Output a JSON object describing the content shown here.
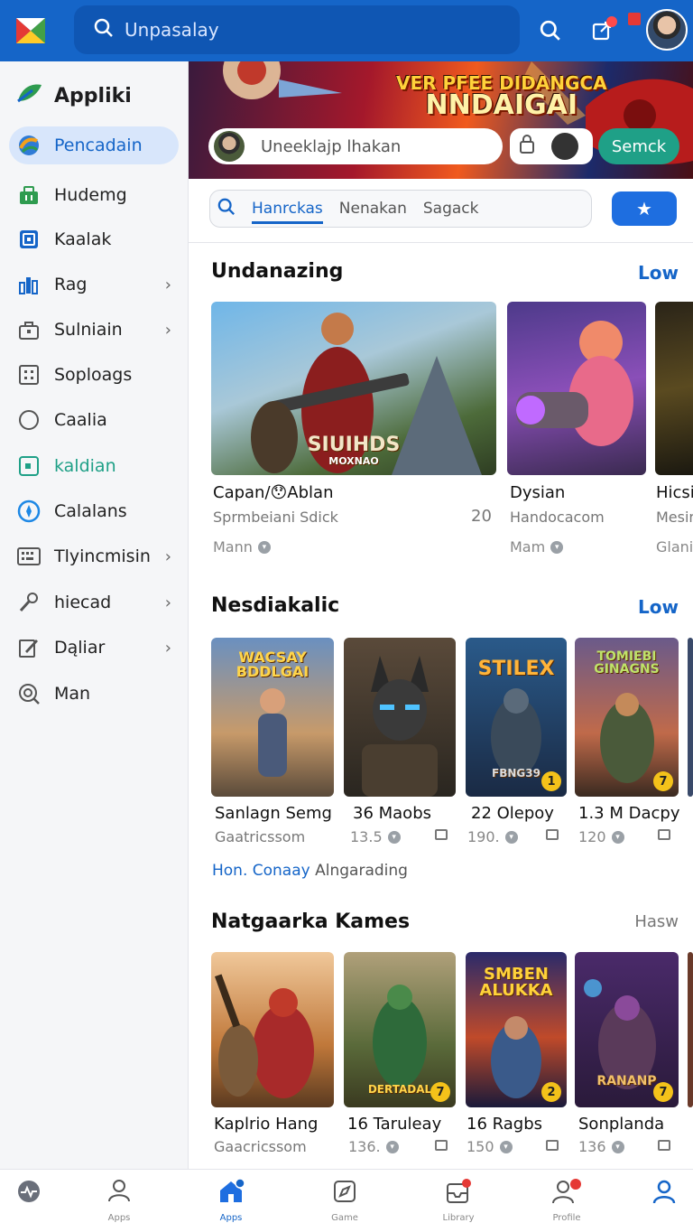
{
  "app": {
    "sidebar_title": "Appliki"
  },
  "search": {
    "placeholder": "Unpasalay"
  },
  "sidebar": {
    "items": [
      {
        "label": "Pencadain",
        "icon": "globe-icon"
      },
      {
        "label": "Hudemg",
        "icon": "store-icon"
      },
      {
        "label": "Kaalak",
        "icon": "tablet-icon"
      },
      {
        "label": "Rag",
        "icon": "chart-icon"
      },
      {
        "label": "Sulniain",
        "icon": "bag-icon"
      },
      {
        "label": "Soploags",
        "icon": "grid-icon"
      },
      {
        "label": "Caalia",
        "icon": "circle-icon"
      },
      {
        "label": "kaldian",
        "icon": "square-icon"
      },
      {
        "label": "Calalans",
        "icon": "compass-icon"
      },
      {
        "label": "Tlyincmisin",
        "icon": "keyboard-icon"
      },
      {
        "label": "hiecad",
        "icon": "wrench-icon"
      },
      {
        "label": "Dąliar",
        "icon": "edit-icon"
      },
      {
        "label": "Man",
        "icon": "search-icon"
      }
    ]
  },
  "banner": {
    "title_line1": "VER PFEE DIDANGCA",
    "title_line2": "NNDAIGAI",
    "input_placeholder": "Uneeklajp lhakan",
    "button": "Semck"
  },
  "filters": {
    "tabs": [
      "Hanrckas",
      "Nenakan",
      "Sagack"
    ]
  },
  "section1": {
    "title": "Undanazing",
    "link": "Low",
    "cards": [
      {
        "name": "Capan/😯Ablan",
        "sub": "Sprmbeiani Sdick",
        "extra": "Mann",
        "count": "20",
        "art_text1": "SIUIHDS",
        "art_text2": "MOXNAO"
      },
      {
        "name": "Dysian",
        "sub": "Handocacom",
        "extra": "Mam"
      },
      {
        "name": "Hicsi",
        "sub": "Mesin",
        "extra": "Glanii"
      }
    ]
  },
  "section2": {
    "title": "Nesdiakalic",
    "link": "Low",
    "cards": [
      {
        "name": "Sanlagn Semg",
        "sub": "Gaatricssom",
        "art_text": "WACSAY BDDLGAI"
      },
      {
        "name": "36 Maobs",
        "sub": "13.5"
      },
      {
        "name": "22 Olepoy",
        "sub": "190.",
        "art_text": "STILEX",
        "art_text2": "FBNG39",
        "badge": "1"
      },
      {
        "name": "1.3 M Dacpy",
        "sub": "120",
        "art_text": "TOMIEBI GINAGNS",
        "badge": "7"
      }
    ],
    "footer_link": "Hon. Conaay",
    "footer_text": "Alngarading"
  },
  "section3": {
    "title": "Natgaarka Kames",
    "link": "Hasw",
    "cards": [
      {
        "name": "Kaplrio Hang",
        "sub": "Gaacricssom"
      },
      {
        "name": "16 Taruleay",
        "sub": "136.",
        "art_text": "DERTADAL",
        "badge": "7"
      },
      {
        "name": "16 Ragbs",
        "sub": "150",
        "art_text": "SMBEN ALUKKA",
        "badge": "2"
      },
      {
        "name": "Sonplanda",
        "sub": "136",
        "art_text": "RANANP",
        "badge": "7"
      }
    ]
  },
  "bottom_nav": {
    "items": [
      {
        "icon": "activity-icon",
        "label": ""
      },
      {
        "icon": "person-icon",
        "label": "Apps"
      },
      {
        "icon": "home-icon",
        "label": "Apps"
      },
      {
        "icon": "compass-icon",
        "label": "Game"
      },
      {
        "icon": "inbox-icon",
        "label": "Library"
      },
      {
        "icon": "user-alert-icon",
        "label": "Profile"
      },
      {
        "icon": "account-icon",
        "label": ""
      }
    ]
  },
  "colors": {
    "primary": "#1565c8",
    "accent_green": "#1fa087",
    "badge": "#f4c21a"
  }
}
